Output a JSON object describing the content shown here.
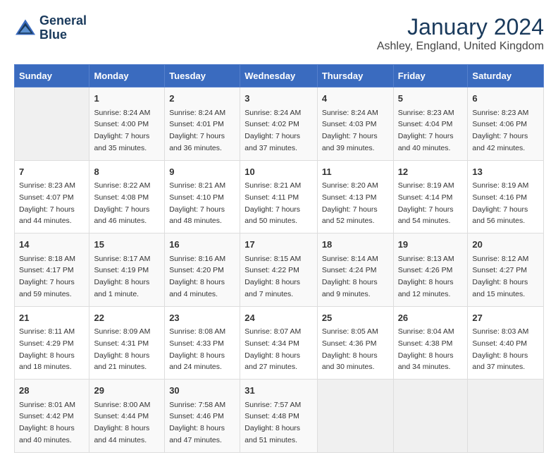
{
  "logo": {
    "line1": "General",
    "line2": "Blue"
  },
  "title": "January 2024",
  "location": "Ashley, England, United Kingdom",
  "days_of_week": [
    "Sunday",
    "Monday",
    "Tuesday",
    "Wednesday",
    "Thursday",
    "Friday",
    "Saturday"
  ],
  "weeks": [
    [
      {
        "day": "",
        "content": ""
      },
      {
        "day": "1",
        "content": "Sunrise: 8:24 AM\nSunset: 4:00 PM\nDaylight: 7 hours\nand 35 minutes."
      },
      {
        "day": "2",
        "content": "Sunrise: 8:24 AM\nSunset: 4:01 PM\nDaylight: 7 hours\nand 36 minutes."
      },
      {
        "day": "3",
        "content": "Sunrise: 8:24 AM\nSunset: 4:02 PM\nDaylight: 7 hours\nand 37 minutes."
      },
      {
        "day": "4",
        "content": "Sunrise: 8:24 AM\nSunset: 4:03 PM\nDaylight: 7 hours\nand 39 minutes."
      },
      {
        "day": "5",
        "content": "Sunrise: 8:23 AM\nSunset: 4:04 PM\nDaylight: 7 hours\nand 40 minutes."
      },
      {
        "day": "6",
        "content": "Sunrise: 8:23 AM\nSunset: 4:06 PM\nDaylight: 7 hours\nand 42 minutes."
      }
    ],
    [
      {
        "day": "7",
        "content": "Sunrise: 8:23 AM\nSunset: 4:07 PM\nDaylight: 7 hours\nand 44 minutes."
      },
      {
        "day": "8",
        "content": "Sunrise: 8:22 AM\nSunset: 4:08 PM\nDaylight: 7 hours\nand 46 minutes."
      },
      {
        "day": "9",
        "content": "Sunrise: 8:21 AM\nSunset: 4:10 PM\nDaylight: 7 hours\nand 48 minutes."
      },
      {
        "day": "10",
        "content": "Sunrise: 8:21 AM\nSunset: 4:11 PM\nDaylight: 7 hours\nand 50 minutes."
      },
      {
        "day": "11",
        "content": "Sunrise: 8:20 AM\nSunset: 4:13 PM\nDaylight: 7 hours\nand 52 minutes."
      },
      {
        "day": "12",
        "content": "Sunrise: 8:19 AM\nSunset: 4:14 PM\nDaylight: 7 hours\nand 54 minutes."
      },
      {
        "day": "13",
        "content": "Sunrise: 8:19 AM\nSunset: 4:16 PM\nDaylight: 7 hours\nand 56 minutes."
      }
    ],
    [
      {
        "day": "14",
        "content": "Sunrise: 8:18 AM\nSunset: 4:17 PM\nDaylight: 7 hours\nand 59 minutes."
      },
      {
        "day": "15",
        "content": "Sunrise: 8:17 AM\nSunset: 4:19 PM\nDaylight: 8 hours\nand 1 minute."
      },
      {
        "day": "16",
        "content": "Sunrise: 8:16 AM\nSunset: 4:20 PM\nDaylight: 8 hours\nand 4 minutes."
      },
      {
        "day": "17",
        "content": "Sunrise: 8:15 AM\nSunset: 4:22 PM\nDaylight: 8 hours\nand 7 minutes."
      },
      {
        "day": "18",
        "content": "Sunrise: 8:14 AM\nSunset: 4:24 PM\nDaylight: 8 hours\nand 9 minutes."
      },
      {
        "day": "19",
        "content": "Sunrise: 8:13 AM\nSunset: 4:26 PM\nDaylight: 8 hours\nand 12 minutes."
      },
      {
        "day": "20",
        "content": "Sunrise: 8:12 AM\nSunset: 4:27 PM\nDaylight: 8 hours\nand 15 minutes."
      }
    ],
    [
      {
        "day": "21",
        "content": "Sunrise: 8:11 AM\nSunset: 4:29 PM\nDaylight: 8 hours\nand 18 minutes."
      },
      {
        "day": "22",
        "content": "Sunrise: 8:09 AM\nSunset: 4:31 PM\nDaylight: 8 hours\nand 21 minutes."
      },
      {
        "day": "23",
        "content": "Sunrise: 8:08 AM\nSunset: 4:33 PM\nDaylight: 8 hours\nand 24 minutes."
      },
      {
        "day": "24",
        "content": "Sunrise: 8:07 AM\nSunset: 4:34 PM\nDaylight: 8 hours\nand 27 minutes."
      },
      {
        "day": "25",
        "content": "Sunrise: 8:05 AM\nSunset: 4:36 PM\nDaylight: 8 hours\nand 30 minutes."
      },
      {
        "day": "26",
        "content": "Sunrise: 8:04 AM\nSunset: 4:38 PM\nDaylight: 8 hours\nand 34 minutes."
      },
      {
        "day": "27",
        "content": "Sunrise: 8:03 AM\nSunset: 4:40 PM\nDaylight: 8 hours\nand 37 minutes."
      }
    ],
    [
      {
        "day": "28",
        "content": "Sunrise: 8:01 AM\nSunset: 4:42 PM\nDaylight: 8 hours\nand 40 minutes."
      },
      {
        "day": "29",
        "content": "Sunrise: 8:00 AM\nSunset: 4:44 PM\nDaylight: 8 hours\nand 44 minutes."
      },
      {
        "day": "30",
        "content": "Sunrise: 7:58 AM\nSunset: 4:46 PM\nDaylight: 8 hours\nand 47 minutes."
      },
      {
        "day": "31",
        "content": "Sunrise: 7:57 AM\nSunset: 4:48 PM\nDaylight: 8 hours\nand 51 minutes."
      },
      {
        "day": "",
        "content": ""
      },
      {
        "day": "",
        "content": ""
      },
      {
        "day": "",
        "content": ""
      }
    ]
  ]
}
